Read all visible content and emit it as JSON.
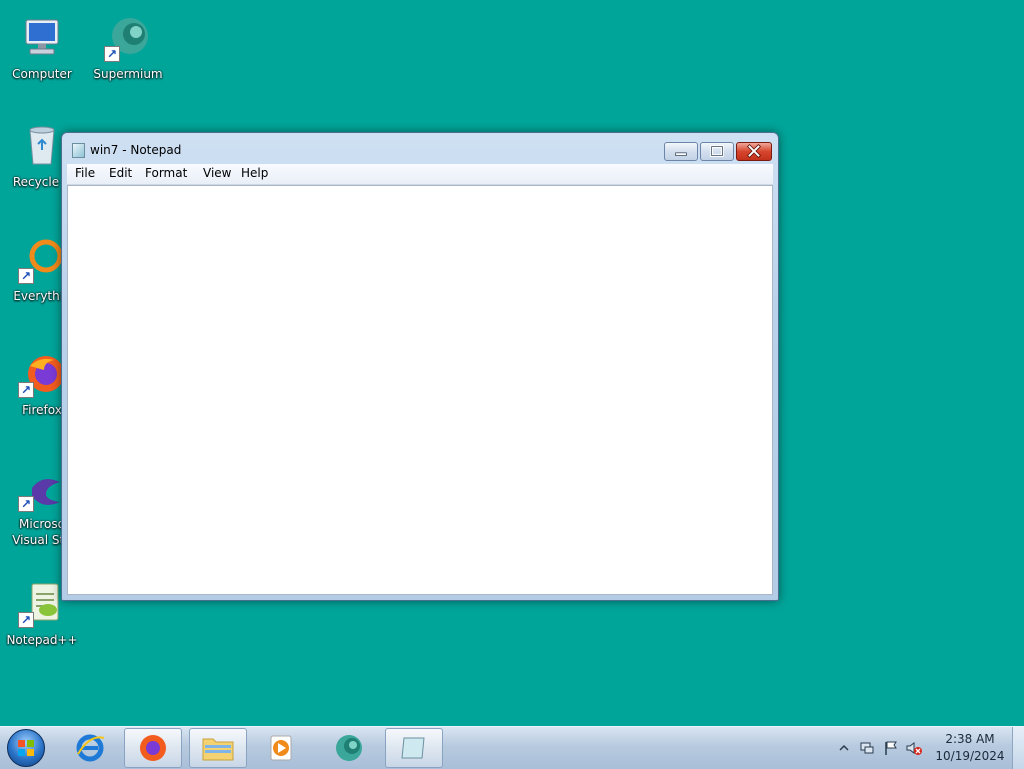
{
  "desktop": {
    "icons": [
      {
        "label": "Computer",
        "icon": "computer-icon",
        "shortcut": false
      },
      {
        "label": "Supermium",
        "icon": "supermium-icon",
        "shortcut": true
      },
      {
        "label": "Recycle B",
        "icon": "recycle-bin-icon",
        "shortcut": false
      },
      {
        "label": "Everythin",
        "icon": "everything-icon",
        "shortcut": true
      },
      {
        "label": "Firefox",
        "icon": "firefox-icon",
        "shortcut": true
      },
      {
        "label": "Microso\nVisual Stu",
        "icon": "visual-studio-icon",
        "shortcut": true
      },
      {
        "label": "Notepad++",
        "icon": "notepadpp-icon",
        "shortcut": true
      }
    ],
    "background_color": "#00a59a"
  },
  "window": {
    "title": "win7 - Notepad",
    "controls": {
      "minimize": "minimize",
      "maximize": "maximize",
      "close": "close"
    },
    "menu": [
      "File",
      "Edit",
      "Format",
      "View",
      "Help"
    ],
    "content": ""
  },
  "taskbar": {
    "start": "start-orb",
    "pinned": [
      {
        "name": "internet-explorer",
        "icon": "ie-icon",
        "active": false
      },
      {
        "name": "firefox",
        "icon": "firefox-icon",
        "active": true
      },
      {
        "name": "explorer",
        "icon": "folder-icon",
        "active": true
      },
      {
        "name": "media-player",
        "icon": "media-player-icon",
        "active": false
      },
      {
        "name": "supermium",
        "icon": "supermium-icon",
        "active": false
      },
      {
        "name": "notepad",
        "icon": "notepad-icon",
        "active": true
      }
    ],
    "tray": {
      "time": "2:38 AM",
      "date": "10/19/2024"
    }
  }
}
